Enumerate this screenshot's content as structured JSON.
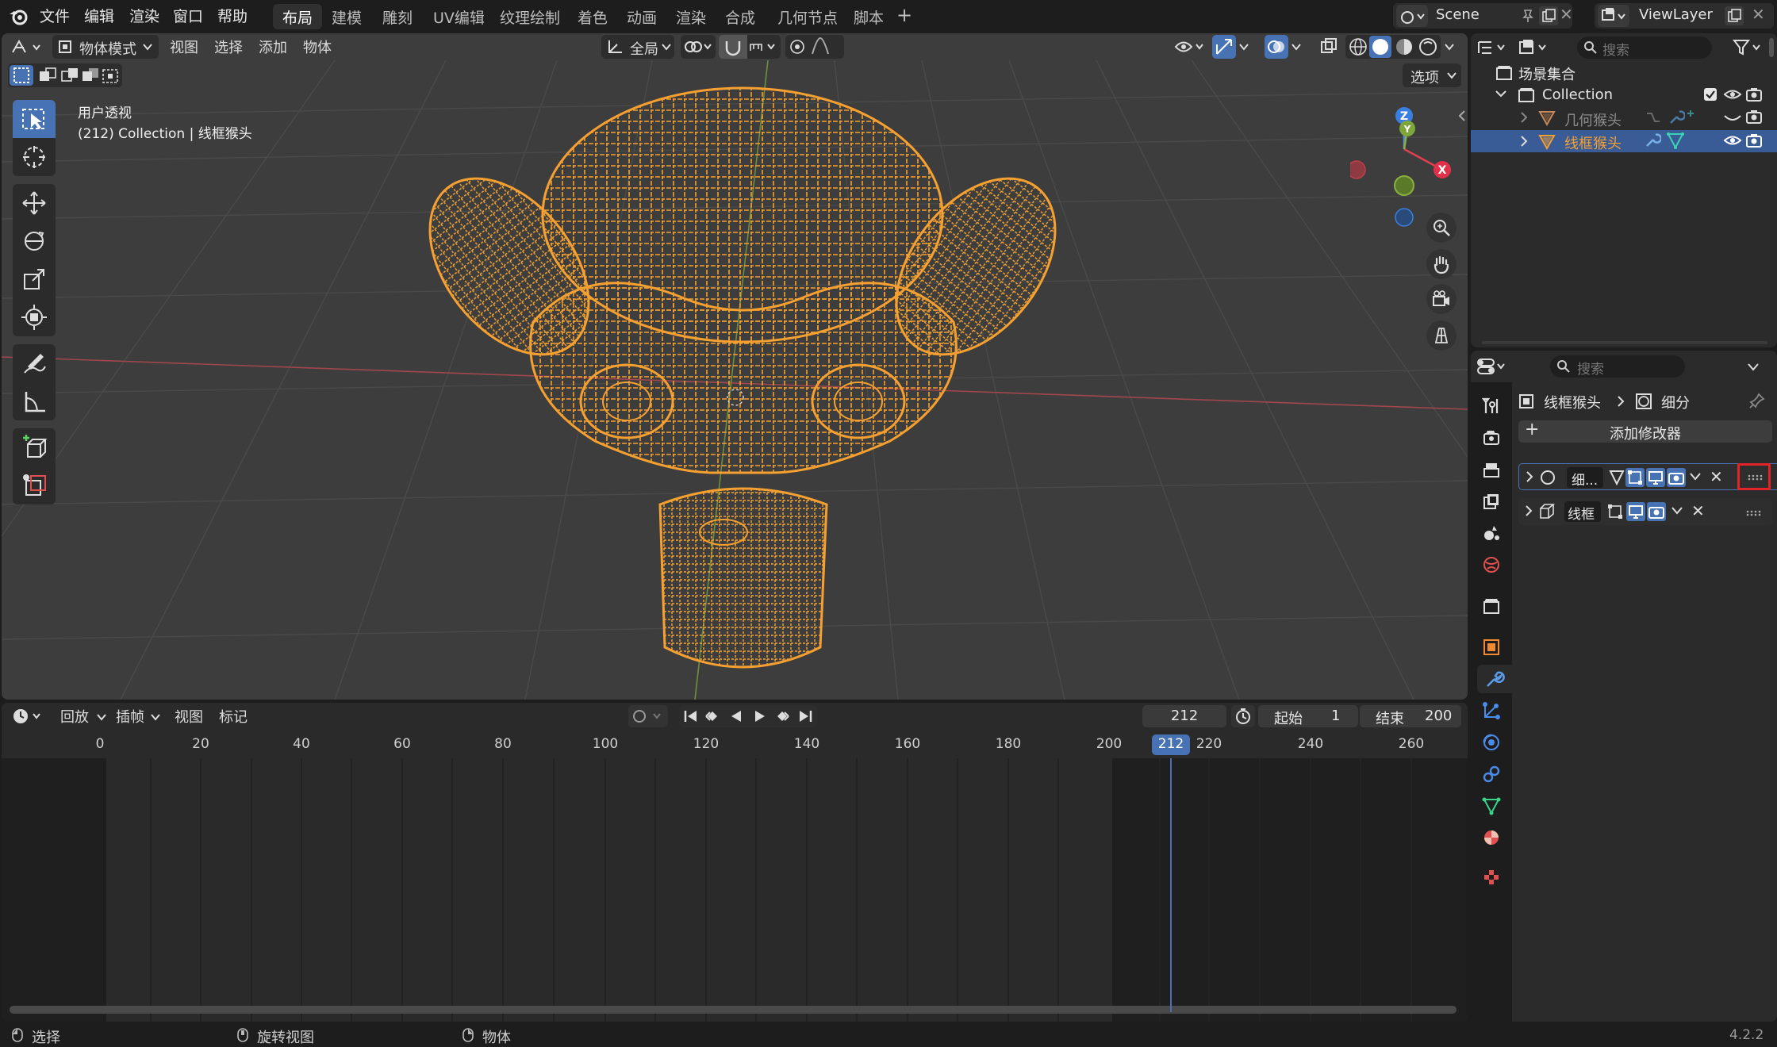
{
  "menu": [
    "文件",
    "编辑",
    "渲染",
    "窗口",
    "帮助"
  ],
  "workspaces": [
    "布局",
    "建模",
    "雕刻",
    "UV编辑",
    "纹理绘制",
    "着色",
    "动画",
    "渲染",
    "合成",
    "几何节点",
    "脚本"
  ],
  "scene": {
    "label": "Scene",
    "view_layer": "ViewLayer"
  },
  "viewport": {
    "mode": "物体模式",
    "menus": [
      "视图",
      "选择",
      "添加",
      "物体"
    ],
    "transform_orientation": "全局",
    "options_label": "选项",
    "info_line1": "用户透视",
    "info_line2": "(212) Collection | 线框猴头",
    "gizmo": {
      "x": "X",
      "y": "Y",
      "z": "Z"
    }
  },
  "timeline": {
    "menus": [
      "回放",
      "插帧",
      "视图",
      "标记"
    ],
    "current_frame": "212",
    "start_label": "起始",
    "start_value": "1",
    "end_label": "结束",
    "end_value": "200",
    "ticks": [
      "0",
      "20",
      "40",
      "60",
      "80",
      "100",
      "120",
      "140",
      "160",
      "180",
      "200",
      "212",
      "220",
      "240",
      "260"
    ]
  },
  "outliner": {
    "search_placeholder": "搜索",
    "scene_collection": "场景集合",
    "collection": "Collection",
    "items": [
      {
        "label": "几何猴头",
        "selected": false
      },
      {
        "label": "线框猴头",
        "selected": true
      }
    ]
  },
  "properties": {
    "search_placeholder": "搜索",
    "breadcrumb_object": "线框猴头",
    "breadcrumb_modifier": "细分",
    "add_modifier": "添加修改器",
    "modifiers": [
      {
        "name": "细...",
        "type": "subdivision"
      },
      {
        "name": "线框",
        "type": "wireframe"
      }
    ]
  },
  "status": {
    "select": "选择",
    "rotate": "旋转视图",
    "object": "物体",
    "version": "4.2.2"
  },
  "colors": {
    "accent": "#4772b3",
    "wire": "#f5a030",
    "highlight_box": "#e0242a"
  }
}
